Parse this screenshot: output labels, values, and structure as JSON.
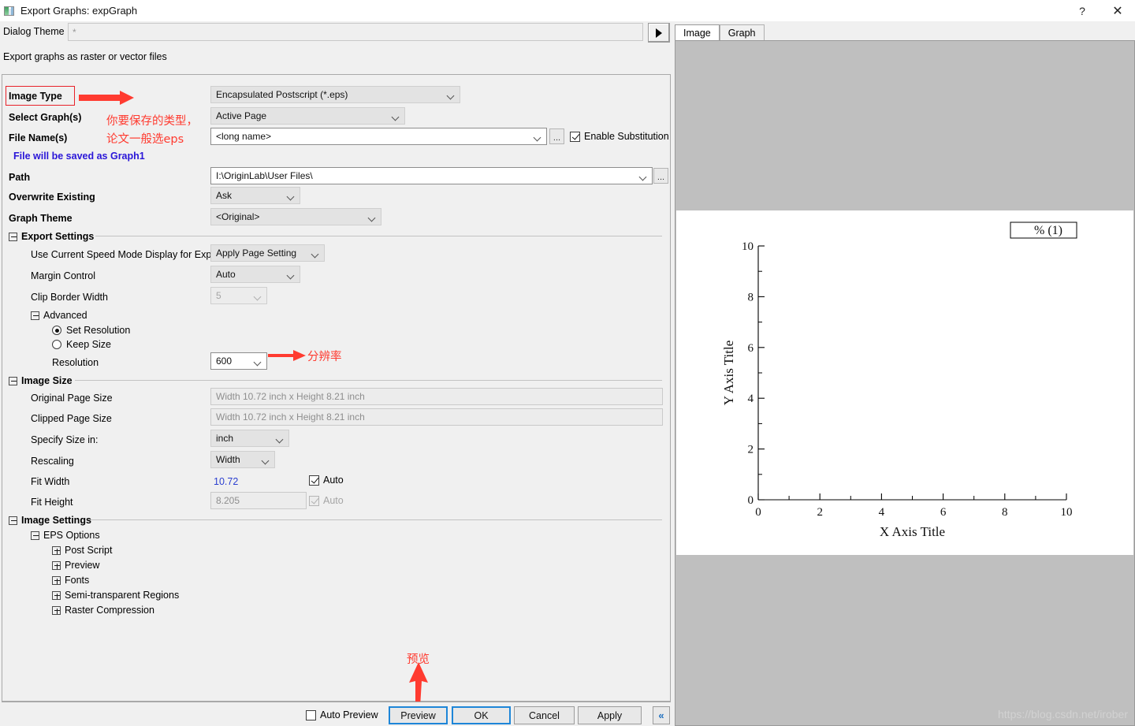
{
  "window": {
    "title": "Export Graphs: expGraph",
    "icon": "app-icon",
    "help_label": "?",
    "close_label": "✕"
  },
  "theme_bar": {
    "label": "Dialog Theme",
    "value": "*",
    "placeholder": "*",
    "arrow_button": "play-arrow-icon"
  },
  "subtitle": "Export graphs as raster or vector files",
  "form": {
    "image_type": {
      "label": "Image Type",
      "value": "Encapsulated Postscript (*.eps)"
    },
    "select_graphs": {
      "label": "Select Graph(s)",
      "value": "Active Page"
    },
    "file_names": {
      "label": "File Name(s)",
      "value": "<long name>",
      "browse": "...",
      "substitution_label": "Enable Substitution",
      "substitution_checked": true
    },
    "save_notice": "File will be saved as Graph1",
    "path": {
      "label": "Path",
      "value": "I:\\OriginLab\\User Files\\",
      "browse": "..."
    },
    "overwrite": {
      "label": "Overwrite Existing",
      "value": "Ask"
    },
    "graph_theme": {
      "label": "Graph Theme",
      "value": "<Original>"
    }
  },
  "export_settings": {
    "group_label": "Export Settings",
    "speed_mode": {
      "label": "Use Current Speed Mode Display for Export",
      "value": "Apply Page Setting"
    },
    "margin_control": {
      "label": "Margin Control",
      "value": "Auto"
    },
    "clip_border_width": {
      "label": "Clip Border Width",
      "value": "5"
    },
    "advanced": {
      "label": "Advanced",
      "set_resolution": {
        "label": "Set Resolution",
        "selected": true
      },
      "keep_size": {
        "label": "Keep Size",
        "selected": false
      },
      "resolution": {
        "label": "Resolution",
        "value": "600"
      }
    }
  },
  "image_size": {
    "group_label": "Image Size",
    "original_page_size": {
      "label": "Original Page Size",
      "value": "Width 10.72 inch x Height 8.21 inch"
    },
    "clipped_page_size": {
      "label": "Clipped Page Size",
      "value": "Width 10.72 inch x Height 8.21 inch"
    },
    "specify_size_in": {
      "label": "Specify Size in:",
      "value": "inch"
    },
    "rescaling": {
      "label": "Rescaling",
      "value": "Width"
    },
    "fit_width": {
      "label": "Fit Width",
      "value": "10.72",
      "auto_label": "Auto",
      "auto_checked": true
    },
    "fit_height": {
      "label": "Fit Height",
      "value": "8.205",
      "auto_label": "Auto",
      "auto_checked": true
    }
  },
  "image_settings": {
    "group_label": "Image Settings",
    "eps_options": "EPS Options",
    "children": [
      "Post Script",
      "Preview",
      "Fonts",
      "Semi-transparent Regions",
      "Raster Compression"
    ]
  },
  "annotations": {
    "image_type_note_line1": "你要保存的类型，",
    "image_type_note_line2": "论文一般选eps",
    "resolution_note": "分辨率",
    "preview_note": "预览",
    "arrow_color": "#ff3b30"
  },
  "footer": {
    "auto_preview": {
      "label": "Auto Preview",
      "checked": false
    },
    "preview_button": "Preview",
    "ok_button": "OK",
    "cancel_button": "Cancel",
    "apply_button": "Apply",
    "collapse_button": "«"
  },
  "preview_panel": {
    "tabs": [
      {
        "label": "Image",
        "active": true
      },
      {
        "label": "Graph",
        "active": false
      }
    ],
    "watermark": "https://blog.csdn.net/irober"
  },
  "chart_data": {
    "type": "scatter",
    "title": "",
    "xlabel": "X Axis Title",
    "ylabel": "Y Axis Title",
    "xlim": [
      0,
      10
    ],
    "ylim": [
      0,
      10
    ],
    "xticks": [
      0,
      2,
      4,
      6,
      8,
      10
    ],
    "yticks": [
      0,
      2,
      4,
      6,
      8,
      10
    ],
    "grid": false,
    "legend_position": "top-right",
    "legend_entries": [
      "% (1)"
    ],
    "series": [
      {
        "name": "% (1)",
        "x": [],
        "y": []
      }
    ]
  }
}
